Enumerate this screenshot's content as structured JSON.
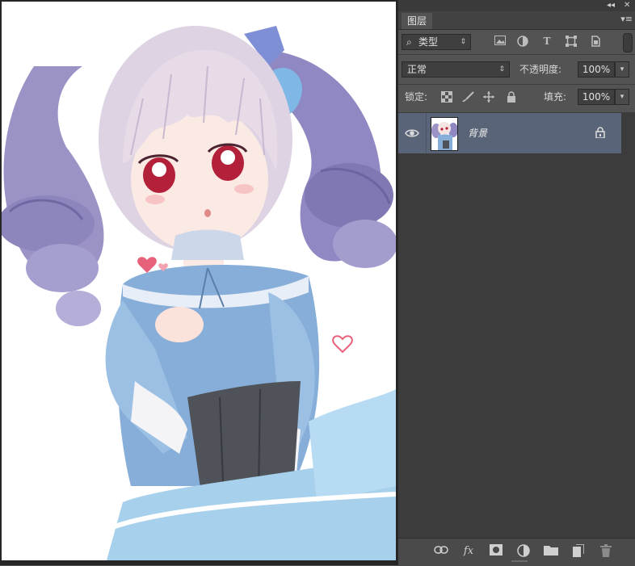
{
  "window": {
    "collapse_icon": "◂◂",
    "close_icon": "✕"
  },
  "panel": {
    "tab_label": "图层",
    "menu_icon": "▾≡",
    "filter": {
      "search_icon": "⌕",
      "kind_label": "类型",
      "pixel_icon": "image",
      "adjust_icon": "half-circle",
      "type_icon": "T",
      "shape_icon": "shape",
      "smart_icon": "smart-object"
    },
    "blend_mode": "正常",
    "opacity_label": "不透明度:",
    "opacity_value": "100%",
    "lock_label": "锁定:",
    "fill_label": "填充:",
    "fill_value": "100%",
    "layers": [
      {
        "name": "背景",
        "visible": true,
        "locked": true
      }
    ],
    "footer_icons": [
      "link-icon",
      "fx-icon",
      "mask-icon",
      "adjustment-icon",
      "folder-icon",
      "new-layer-icon",
      "trash-icon"
    ],
    "fx_label": "fx"
  },
  "colors": {
    "panel_bg": "#535353",
    "selected_layer": "#5a6478",
    "list_bg": "#3c3c3c"
  }
}
